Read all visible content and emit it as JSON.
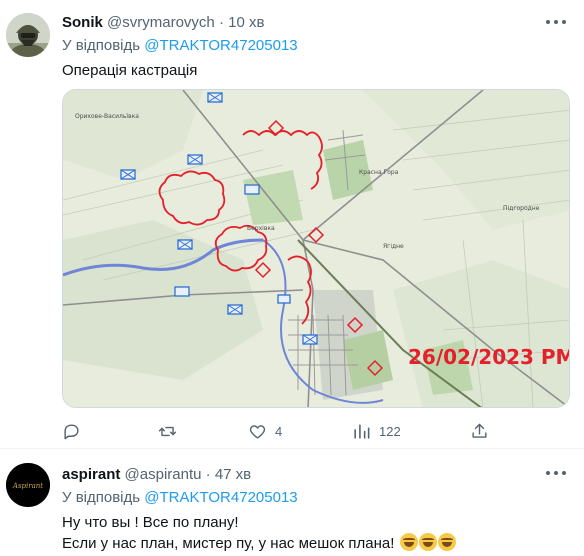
{
  "tweets": [
    {
      "author_name": "Sonik",
      "handle": "@svrymarovych",
      "separator": "·",
      "time": "10 хв",
      "reply_prefix": "У відповідь",
      "reply_to": "@TRAKTOR47205013",
      "text": "Операція кастрація",
      "media": {
        "map_labels": {
          "stamp": "26/02/2023 PM",
          "town": "Красна Гора",
          "village1": "Берхівка",
          "village2": "Ягідне",
          "village3": "Орихове-Васильївка",
          "village4": "Підгородне"
        }
      },
      "actions": {
        "replies": "",
        "retweets": "",
        "likes": "4",
        "views": "122"
      }
    },
    {
      "author_name": "aspirant",
      "handle": "@aspirantu",
      "separator": "·",
      "time": "47 хв",
      "reply_prefix": "У відповідь",
      "reply_to": "@TRAKTOR47205013",
      "text_line1": "Ну что вы ! Все по плану!",
      "text_line2": "Если у нас план, мистер пу, у нас мешок плана!",
      "avatar_text": "Aspirant"
    }
  ],
  "icons": [
    "reply-icon",
    "retweet-icon",
    "like-icon",
    "views-icon",
    "share-icon",
    "more-icon"
  ],
  "colors": {
    "link": "#1d9bf0",
    "muted": "#536471",
    "map_red": "#e4202a",
    "map_blue": "#2f6fd1"
  }
}
